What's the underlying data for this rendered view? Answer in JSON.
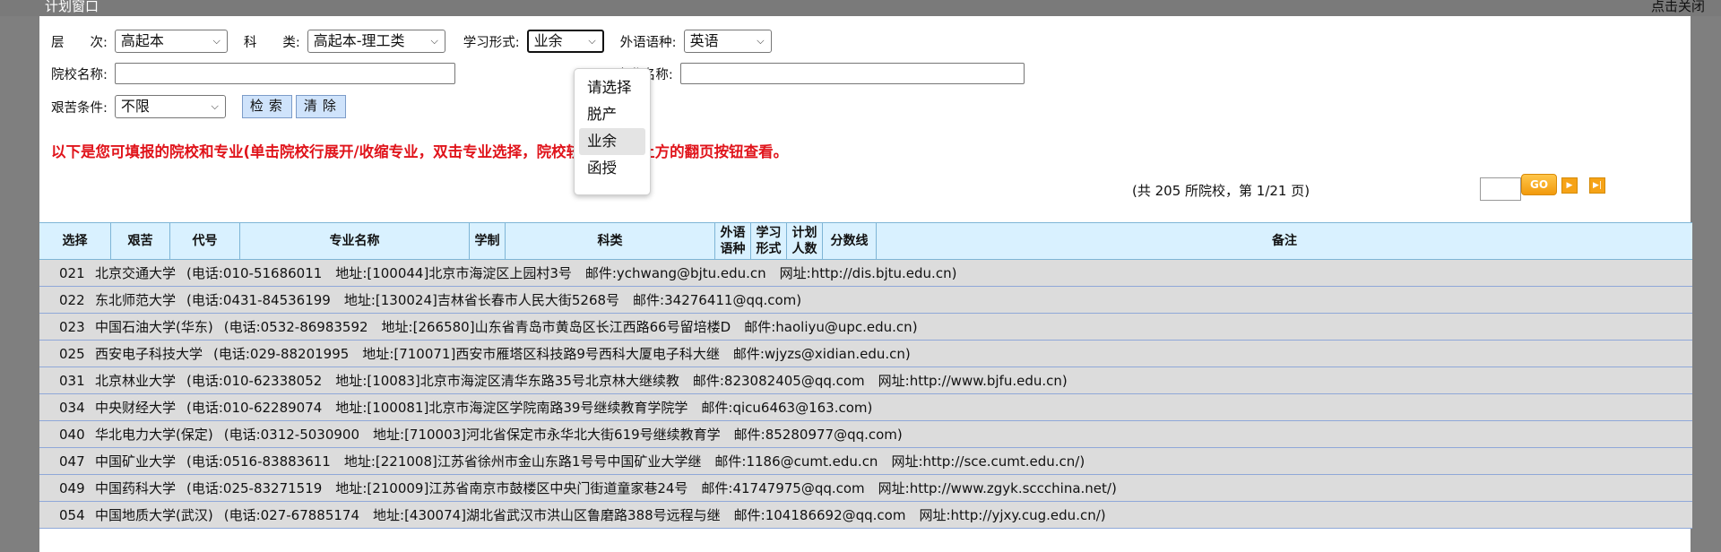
{
  "window": {
    "title": "计划窗口",
    "close_label": "点击关闭"
  },
  "filters": {
    "level_label": "层　　次:",
    "level_value": "高起本",
    "subject_label": "科　　类:",
    "subject_value": "高起本-理工类",
    "study_form_label": "学习形式:",
    "study_form_value": "业余",
    "language_label": "外语语种:",
    "language_value": "英语",
    "school_label": "院校名称:",
    "school_value": "",
    "major_label": "专业名称:",
    "major_value": "",
    "hardship_label": "艰苦条件:",
    "hardship_value": "不限",
    "search_btn": "检索",
    "clear_btn": "清除"
  },
  "dropdown": {
    "options": [
      "请选择",
      "脱产",
      "业余",
      "函授"
    ],
    "selected_index": 2
  },
  "notice": "以下是您可填报的院校和专业(单击院校行展开/收缩专业，双击专业选择，院校较多可用右上方的翻页按钮查看。",
  "pager": {
    "info": "(共 205 所院校，第 1/21 页)",
    "page_input": "",
    "go_label": "GO"
  },
  "table": {
    "headers": [
      {
        "key": "select",
        "label": "选择"
      },
      {
        "key": "hardship",
        "label": "艰苦"
      },
      {
        "key": "code",
        "label": "代号"
      },
      {
        "key": "major",
        "label": "专业名称"
      },
      {
        "key": "years",
        "label": "学制"
      },
      {
        "key": "category",
        "label": "科类"
      },
      {
        "key": "language",
        "label": "外语语种"
      },
      {
        "key": "form",
        "label": "学习形式"
      },
      {
        "key": "plan",
        "label": "计划人数"
      },
      {
        "key": "score",
        "label": "分数线"
      },
      {
        "key": "remark",
        "label": "备注"
      }
    ],
    "rows": [
      {
        "code": "021",
        "name": "北京交通大学",
        "info": "(电话:010-51686011　地址:[100044]北京市海淀区上园村3号　邮件:ychwang@bjtu.edu.cn　网址:http://dis.bjtu.edu.cn)"
      },
      {
        "code": "022",
        "name": "东北师范大学",
        "info": "(电话:0431-84536199　地址:[130024]吉林省长春市人民大街5268号　邮件:34276411@qq.com)"
      },
      {
        "code": "023",
        "name": "中国石油大学(华东)",
        "info": "(电话:0532-86983592　地址:[266580]山东省青岛市黄岛区长江西路66号留培楼D　邮件:haoliyu@upc.edu.cn)"
      },
      {
        "code": "025",
        "name": "西安电子科技大学",
        "info": "(电话:029-88201995　地址:[710071]西安市雁塔区科技路9号西科大厦电子科大继　邮件:wjyzs@xidian.edu.cn)"
      },
      {
        "code": "031",
        "name": "北京林业大学",
        "info": "(电话:010-62338052　地址:[10083]北京市海淀区清华东路35号北京林大继续教　邮件:823082405@qq.com　网址:http://www.bjfu.edu.cn)"
      },
      {
        "code": "034",
        "name": "中央财经大学",
        "info": "(电话:010-62289074　地址:[100081]北京市海淀区学院南路39号继续教育学院学　邮件:qicu6463@163.com)"
      },
      {
        "code": "040",
        "name": "华北电力大学(保定)",
        "info": "(电话:0312-5030900　地址:[710003]河北省保定市永华北大街619号继续教育学　邮件:85280977@qq.com)"
      },
      {
        "code": "047",
        "name": "中国矿业大学",
        "info": "(电话:0516-83883611　地址:[221008]江苏省徐州市金山东路1号号中国矿业大学继　邮件:1186@cumt.edu.cn　网址:http://sce.cumt.edu.cn/)"
      },
      {
        "code": "049",
        "name": "中国药科大学",
        "info": "(电话:025-83271519　地址:[210009]江苏省南京市鼓楼区中央门街道童家巷24号　邮件:41747975@qq.com　网址:http://www.zgyk.sccchina.net/)"
      },
      {
        "code": "054",
        "name": "中国地质大学(武汉)",
        "info": "(电话:027-67885174　地址:[430074]湖北省武汉市洪山区鲁磨路388号远程与继　邮件:104186692@qq.com　网址:http://yjxy.cug.edu.cn/)"
      }
    ]
  }
}
